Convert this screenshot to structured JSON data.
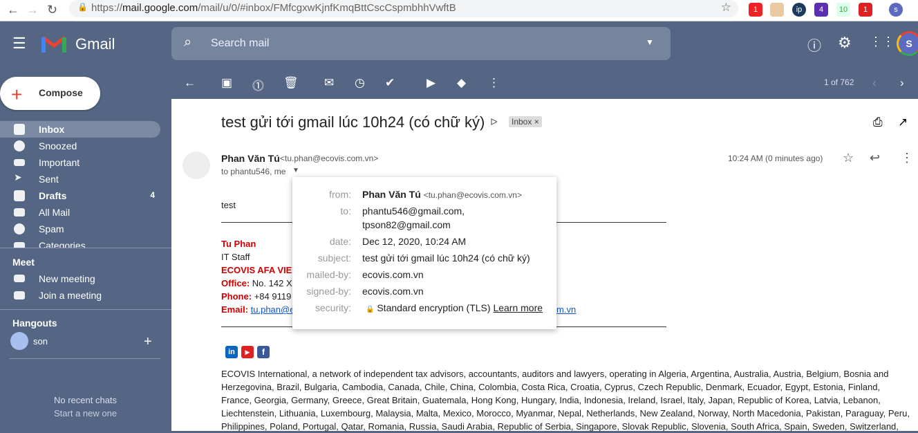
{
  "browser": {
    "url_prefix": "https://",
    "url_host": "mail.google.com",
    "url_path": "/mail/u/0/#inbox/FMfcgxwKjnfKmqBttCscCspmbhhVwftB",
    "ext_badges": [
      "1",
      "4",
      "10",
      "1"
    ],
    "profile": "s"
  },
  "header": {
    "app": "Gmail",
    "search_placeholder": "Search mail",
    "avatar": "S"
  },
  "compose": "Compose",
  "nav": [
    {
      "label": "Inbox",
      "active": true
    },
    {
      "label": "Snoozed"
    },
    {
      "label": "Important"
    },
    {
      "label": "Sent"
    },
    {
      "label": "Drafts",
      "count": "4"
    },
    {
      "label": "All Mail"
    },
    {
      "label": "Spam"
    },
    {
      "label": "Categories"
    }
  ],
  "meet": {
    "title": "Meet",
    "items": [
      "New meeting",
      "Join a meeting"
    ]
  },
  "hangouts": {
    "title": "Hangouts",
    "user": "son",
    "empty": "No recent chats",
    "start": "Start a new one"
  },
  "toolbar": {
    "pager": "1 of 762"
  },
  "email": {
    "subject": "test gửi tới gmail lúc 10h24 (có chữ ký)",
    "label": "Inbox",
    "sender_name": "Phan Văn Tú",
    "sender_email": "<tu.phan@ecovis.com.vn>",
    "to_line": "to phantu546, me",
    "time": "10:24 AM (0 minutes ago)",
    "body": "test",
    "sig": {
      "name": "Tu Phan",
      "title": "IT Staff",
      "company": "ECOVIS AFA VIE",
      "office_label": "Office:",
      "office": "No. 142 X",
      "phone_label": "Phone:",
      "phone": "+84 9119",
      "email_label": "Email:",
      "email": "tu.phan@e",
      "email_tail": "m.vn"
    },
    "footer": "ECOVIS International, a network of independent tax advisors, accountants, auditors and lawyers, operating in Algeria, Argentina, Australia, Austria, Belgium, Bosnia and Herzegovina, Brazil, Bulgaria, Cambodia, Canada, Chile, China, Colombia, Costa Rica, Croatia, Cyprus, Czech Republic, Denmark, Ecuador, Egypt, Estonia, Finland, France, Georgia, Germany, Greece, Great Britain, Guatemala, Hong Kong, Hungary, India, Indonesia, Ireland, Israel, Italy, Japan, Republic of Korea, Latvia, Lebanon, Liechtenstein, Lithuania, Luxembourg, Malaysia, Malta, Mexico, Morocco, Myanmar, Nepal, Netherlands, New Zealand, Norway, North Macedonia, Pakistan, Paraguay, Peru, Philippines, Poland, Portugal, Qatar, Romania, Russia, Saudi Arabia, Republic of Serbia, Singapore, Slovak Republic, Slovenia, South Africa, Spain, Sweden, Switzerland,"
  },
  "details": {
    "from_k": "from:",
    "from_name": "Phan Văn Tú",
    "from_email": "<tu.phan@ecovis.com.vn>",
    "to_k": "to:",
    "to1": "phantu546@gmail.com,",
    "to2": "tpson82@gmail.com",
    "date_k": "date:",
    "date": "Dec 12, 2020, 10:24 AM",
    "subject_k": "subject:",
    "subject": "test gửi tới gmail lúc 10h24 (có chữ ký)",
    "mailed_k": "mailed-by:",
    "mailed": "ecovis.com.vn",
    "signed_k": "signed-by:",
    "signed": "ecovis.com.vn",
    "security_k": "security:",
    "security": "Standard encryption (TLS)",
    "learn": "Learn more"
  },
  "colors": {
    "theme": "#546683",
    "accent_red": "#cc0000",
    "link": "#1155cc"
  }
}
